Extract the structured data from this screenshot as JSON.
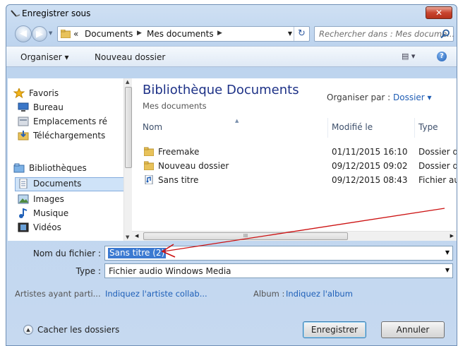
{
  "window": {
    "title": "Enregistrer sous",
    "close_label": "✕"
  },
  "address": {
    "overflow": "«",
    "crumbs": [
      "Documents",
      "Mes documents"
    ],
    "search_placeholder": "Rechercher dans : Mes docume..."
  },
  "toolbar": {
    "organize": "Organiser ▾",
    "new_folder": "Nouveau dossier",
    "view_icon": "view-icon",
    "help": "?"
  },
  "nav": {
    "favorites": "Favoris",
    "desktop": "Bureau",
    "recent_places": "Emplacements ré",
    "downloads": "Téléchargements",
    "libraries": "Bibliothèques",
    "documents": "Documents",
    "images": "Images",
    "music": "Musique",
    "videos": "Vidéos"
  },
  "main": {
    "library_title": "Bibliothèque Documents",
    "library_sub": "Mes documents",
    "arrange_label": "Organiser par :",
    "arrange_value": "Dossier ▾",
    "columns": {
      "name": "Nom",
      "modified": "Modifié le",
      "type": "Type"
    },
    "rows": [
      {
        "name": "Freemake",
        "modified": "01/11/2015 16:10",
        "type": "Dossier de",
        "icon": "folder-icon"
      },
      {
        "name": "Nouveau dossier",
        "modified": "09/12/2015 09:02",
        "type": "Dossier de",
        "icon": "folder-icon"
      },
      {
        "name": "Sans titre",
        "modified": "09/12/2015 08:43",
        "type": "Fichier au",
        "icon": "audio-file-icon"
      }
    ],
    "hscroll_grip": "III"
  },
  "form": {
    "filename_label": "Nom du fichier :",
    "filename_value": "Sans titre (2)",
    "type_label": "Type :",
    "type_value": "Fichier audio Windows Media",
    "artists_label": "Artistes ayant parti...",
    "artists_link": "Indiquez l'artiste collab...",
    "album_label": "Album :",
    "album_link": "Indiquez l'album"
  },
  "footer": {
    "hide_folders": "Cacher les dossiers",
    "save": "Enregistrer",
    "cancel": "Annuler"
  },
  "colors": {
    "accent": "#1e3287",
    "link": "#1d5fb8",
    "selection": "#3b79d1",
    "annotation_arrow": "#cc1111"
  }
}
